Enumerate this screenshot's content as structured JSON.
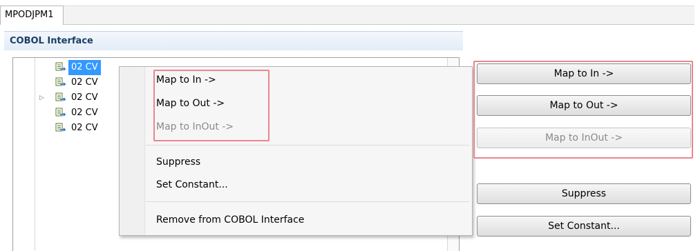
{
  "editor_tab": {
    "label": "MPODJPM1"
  },
  "section": {
    "title": "COBOL Interface"
  },
  "tree": {
    "rows": [
      {
        "label": "02 CV",
        "suffix": "",
        "selected": true,
        "expandable": false
      },
      {
        "label": "02 CV",
        "suffix": "",
        "selected": false,
        "expandable": false
      },
      {
        "label": "02 CV",
        "suffix": "",
        "selected": false,
        "expandable": true
      },
      {
        "label": "02 CV",
        "suffix": "",
        "selected": false,
        "expandable": false
      },
      {
        "label": "02 CV",
        "suffix": "",
        "selected": false,
        "expandable": false
      }
    ]
  },
  "context_menu": {
    "items": [
      {
        "label": "Map to In ->",
        "enabled": true
      },
      {
        "label": "Map to Out ->",
        "enabled": true
      },
      {
        "label": "Map to InOut ->",
        "enabled": false
      },
      {
        "label": "Suppress",
        "enabled": true
      },
      {
        "label": "Set Constant...",
        "enabled": true
      },
      {
        "label": "Remove from COBOL Interface",
        "enabled": true
      }
    ]
  },
  "buttons": {
    "map_in": "Map to In ->",
    "map_out": "Map to Out ->",
    "map_inout": "Map to InOut ->",
    "suppress": "Suppress",
    "set_constant": "Set Constant..."
  },
  "icons": {
    "tree_item": "cobol-field-icon",
    "expander": "expand-arrow-icon"
  },
  "colors": {
    "selection": "#3399ff",
    "highlight_frame": "#e8868c",
    "section_header_text": "#1b3d66"
  }
}
